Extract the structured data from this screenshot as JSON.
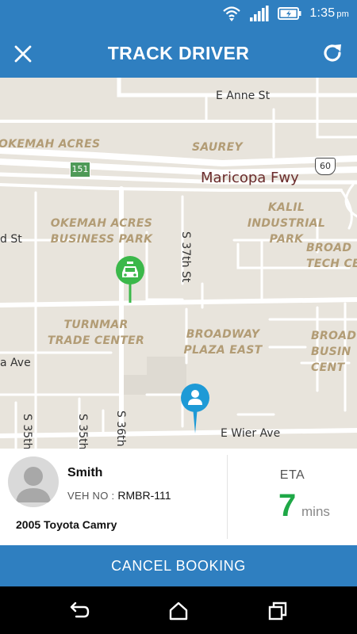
{
  "status_bar": {
    "time": "1:35",
    "ampm": "pm"
  },
  "header": {
    "title": "TRACK DRIVER"
  },
  "map": {
    "streets": {
      "e_anne_st": "E Anne St",
      "maricopa_fwy": "Maricopa Fwy",
      "d_st": "d St",
      "a_ave": "a Ave",
      "s_37th_st": "S 37th St",
      "s_36th": "S 36th",
      "s_35th_a": "S 35th",
      "s_35th_b": "S 35th",
      "e_wier_ave": "E Wier Ave"
    },
    "shields": {
      "route_151": "151",
      "route_60": "60"
    },
    "areas": {
      "okemah_acres": "OKEMAH ACRES",
      "saurey": "SAUREY",
      "okemah_bp_1": "OKEMAH ACRES",
      "okemah_bp_2": "BUSINESS PARK",
      "kalil_1": "KALIL",
      "kalil_2": "INDUSTRIAL PARK",
      "broad_tech_1": "BROAD",
      "broad_tech_2": "TECH CE",
      "turnmar_1": "TURNMAR",
      "turnmar_2": "TRADE CENTER",
      "broadway_1": "BROADWAY",
      "broadway_2": "PLAZA EAST",
      "broad_bus_1": "BROAD",
      "broad_bus_2": "BUSIN",
      "broad_bus_3": "CENT"
    },
    "markers": {
      "driver": "taxi-marker",
      "user": "user-marker"
    }
  },
  "driver": {
    "name": "Smith",
    "vehicle_label": "VEH NO :",
    "vehicle_number": "RMBR-111",
    "car_model": "2005 Toyota Camry"
  },
  "eta": {
    "label": "ETA",
    "value": "7",
    "unit": "mins"
  },
  "actions": {
    "cancel_label": "CANCEL BOOKING"
  },
  "colors": {
    "primary": "#2f7fc0",
    "eta_green": "#1fa847",
    "taxi_green": "#3bb84a",
    "user_blue": "#1e9ad6"
  }
}
